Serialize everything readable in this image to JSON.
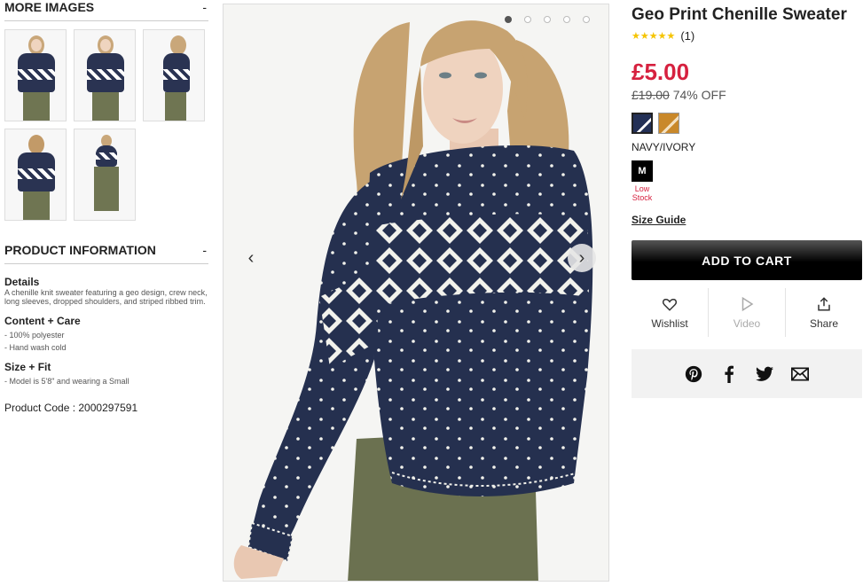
{
  "more_images": {
    "heading": "MORE IMAGES",
    "toggle": "-",
    "thumbnail_count": 5
  },
  "product_info": {
    "heading": "PRODUCT INFORMATION",
    "toggle": "-",
    "details_title": "Details",
    "details_text": "A chenille knit sweater featuring a geo design, crew neck, long sleeves, dropped shoulders, and striped ribbed trim.",
    "care_title": "Content + Care",
    "care_items": [
      "- 100% polyester",
      "- Hand wash cold"
    ],
    "fit_title": "Size + Fit",
    "fit_items": [
      "- Model is 5'8\" and wearing a Small"
    ],
    "product_code": "Product Code : 2000297591"
  },
  "gallery": {
    "slide_count": 5,
    "active_slide": 1,
    "prev_icon": "chevron-left-icon",
    "next_icon": "chevron-right-icon"
  },
  "product": {
    "title": "Geo Print Chenille Sweater",
    "stars": "★★★★★",
    "rating": 5,
    "review_count": "(1)",
    "price": "£5.00",
    "old_price": "£19.00",
    "discount": "74% OFF",
    "selected_color": "NAVY/IVORY",
    "size": "M",
    "stock": "Low Stock",
    "size_guide": "Size Guide",
    "add_to_cart": "ADD TO CART",
    "accent_color": "#d6213f"
  },
  "actions": {
    "wishlist": "Wishlist",
    "video": "Video",
    "share": "Share"
  },
  "social": [
    "pinterest-icon",
    "facebook-icon",
    "twitter-icon",
    "email-icon"
  ]
}
